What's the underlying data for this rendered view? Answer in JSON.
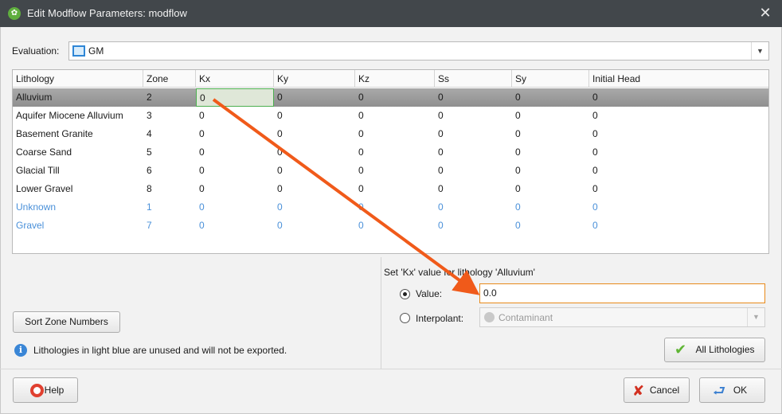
{
  "window": {
    "title": "Edit Modflow Parameters: modflow",
    "app_icon_glyph": "✿",
    "close_glyph": "✕"
  },
  "evaluation": {
    "label": "Evaluation:",
    "value": "GM",
    "dropdown_glyph": "▼"
  },
  "table": {
    "headers": [
      "Lithology",
      "Zone",
      "Kx",
      "Ky",
      "Kz",
      "Ss",
      "Sy",
      "Initial Head"
    ],
    "rows": [
      {
        "lithology": "Alluvium",
        "zone": "2",
        "kx": "0",
        "ky": "0",
        "kz": "0",
        "ss": "0",
        "sy": "0",
        "ih": "0",
        "state": "selected"
      },
      {
        "lithology": "Aquifer Miocene Alluvium",
        "zone": "3",
        "kx": "0",
        "ky": "0",
        "kz": "0",
        "ss": "0",
        "sy": "0",
        "ih": "0",
        "state": "normal"
      },
      {
        "lithology": "Basement Granite",
        "zone": "4",
        "kx": "0",
        "ky": "0",
        "kz": "0",
        "ss": "0",
        "sy": "0",
        "ih": "0",
        "state": "normal"
      },
      {
        "lithology": "Coarse Sand",
        "zone": "5",
        "kx": "0",
        "ky": "0",
        "kz": "0",
        "ss": "0",
        "sy": "0",
        "ih": "0",
        "state": "normal"
      },
      {
        "lithology": "Glacial Till",
        "zone": "6",
        "kx": "0",
        "ky": "0",
        "kz": "0",
        "ss": "0",
        "sy": "0",
        "ih": "0",
        "state": "normal"
      },
      {
        "lithology": "Lower Gravel",
        "zone": "8",
        "kx": "0",
        "ky": "0",
        "kz": "0",
        "ss": "0",
        "sy": "0",
        "ih": "0",
        "state": "normal"
      },
      {
        "lithology": "Unknown",
        "zone": "1",
        "kx": "0",
        "ky": "0",
        "kz": "0",
        "ss": "0",
        "sy": "0",
        "ih": "0",
        "state": "unused"
      },
      {
        "lithology": "Gravel",
        "zone": "7",
        "kx": "0",
        "ky": "0",
        "kz": "0",
        "ss": "0",
        "sy": "0",
        "ih": "0",
        "state": "unused"
      }
    ]
  },
  "setter": {
    "label": "Set 'Kx' value for lithology 'Alluvium'",
    "value_label": "Value:",
    "value_input": "0.0",
    "interpolant_label": "Interpolant:",
    "interpolant_value": "Contaminant",
    "dropdown_glyph": "▼"
  },
  "buttons": {
    "sort_zone": "Sort Zone Numbers",
    "all_lithologies": "All Lithologies",
    "help": "Help",
    "cancel": "Cancel",
    "ok": "OK"
  },
  "info": {
    "glyph": "i",
    "text": "Lithologies in light blue are unused and will not be exported."
  },
  "colors": {
    "unused_text": "#4a90d9",
    "annotation_arrow": "#f05a1a",
    "input_focus_border": "#e88a1a",
    "check_green": "#5fb534"
  }
}
